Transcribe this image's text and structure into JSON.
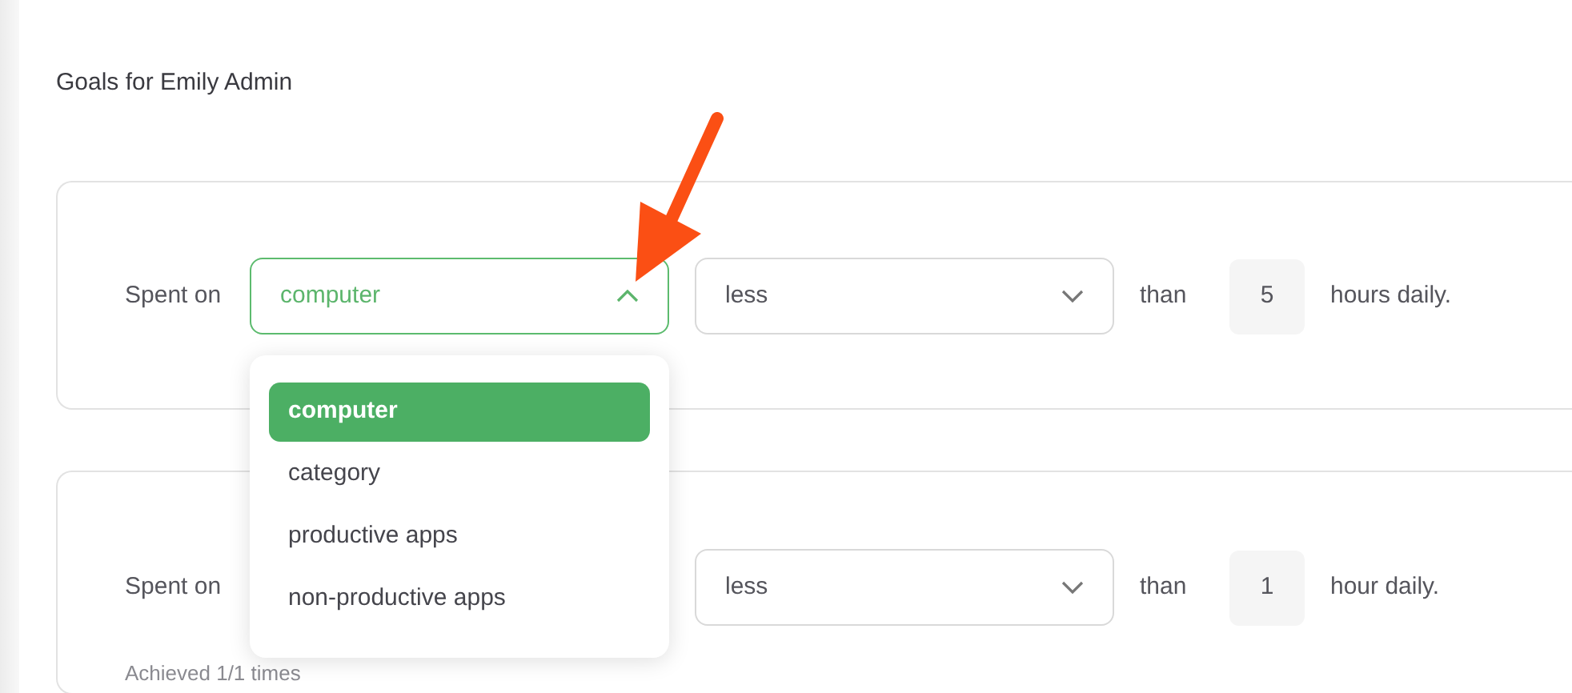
{
  "title": "Goals for Emily Admin",
  "goals": [
    {
      "prefix": "Spent on",
      "spent_on": {
        "value": "computer",
        "open": true,
        "options": [
          {
            "label": "computer",
            "selected": true
          },
          {
            "label": "category",
            "selected": false
          },
          {
            "label": "productive apps",
            "selected": false
          },
          {
            "label": "non-productive apps",
            "selected": false
          }
        ]
      },
      "comparison": "less",
      "than": "than",
      "amount": "5",
      "unit": "hours daily."
    },
    {
      "prefix": "Spent on",
      "comparison": "less",
      "than": "than",
      "amount": "1",
      "unit": "hour daily.",
      "achieved": "Achieved 1/1 times"
    }
  ]
}
